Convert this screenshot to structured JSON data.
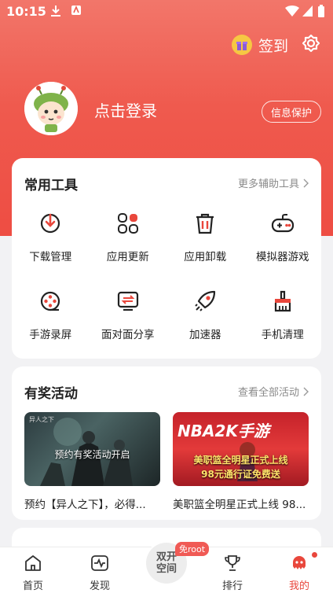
{
  "status": {
    "time": "10:15"
  },
  "header": {
    "sign_label": "签到",
    "login_text": "点击登录",
    "privacy_label": "信息保护"
  },
  "tools": {
    "title": "常用工具",
    "more": "更多辅助工具",
    "items": [
      {
        "label": "下载管理",
        "icon": "download-icon"
      },
      {
        "label": "应用更新",
        "icon": "app-update-icon"
      },
      {
        "label": "应用卸载",
        "icon": "trash-icon"
      },
      {
        "label": "模拟器游戏",
        "icon": "gamepad-icon"
      },
      {
        "label": "手游录屏",
        "icon": "film-reel-icon"
      },
      {
        "label": "面对面分享",
        "icon": "transfer-icon"
      },
      {
        "label": "加速器",
        "icon": "rocket-icon"
      },
      {
        "label": "手机清理",
        "icon": "broom-icon"
      }
    ]
  },
  "activities": {
    "title": "有奖活动",
    "more": "查看全部活动",
    "items": [
      {
        "caption": "预约【异人之下】，必得...",
        "image_text": "预约有奖活动开启",
        "corner_text": "异人之下"
      },
      {
        "caption": "美职篮全明星正式上线 98...",
        "image_text": "美职篮全明星正式上线",
        "image_text2": "98元通行证免费送",
        "banner_title": "NBA2K手游"
      }
    ]
  },
  "tabbar": {
    "items": [
      {
        "label": "首页",
        "icon": "home-icon"
      },
      {
        "label": "发现",
        "icon": "discover-icon"
      },
      {
        "label": "排行",
        "icon": "trophy-icon"
      },
      {
        "label": "我的",
        "icon": "profile-icon"
      }
    ],
    "center_label": "双开空间",
    "center_badge": "免root",
    "active": "我的"
  },
  "colors": {
    "accent": "#ee4d43",
    "gift": "#f6c743"
  }
}
